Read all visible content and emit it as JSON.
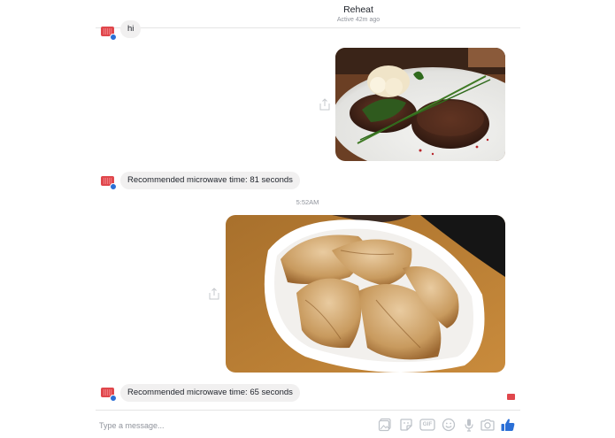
{
  "header": {
    "title": "Reheat",
    "status": "Active 42m ago"
  },
  "messages": [
    {
      "type": "text",
      "from": "bot",
      "text": "hi"
    },
    {
      "type": "image",
      "from": "user",
      "alt": "steak"
    },
    {
      "type": "text",
      "from": "bot",
      "text": "Recommended microwave time: 81 seconds"
    },
    {
      "type": "timestamp",
      "text": "5:52AM"
    },
    {
      "type": "image",
      "from": "user",
      "alt": "dumplings"
    },
    {
      "type": "text",
      "from": "bot",
      "text": "Recommended microwave time: 65 seconds"
    }
  ],
  "composer": {
    "placeholder": "Type a message...",
    "icons": [
      "photos-icon",
      "sticker-icon",
      "gif-icon",
      "emoji-icon",
      "mic-icon",
      "camera-icon",
      "like-icon"
    ],
    "gif_label": "GIF"
  },
  "colors": {
    "accent": "#0084ff",
    "bubble": "#f1f0f0",
    "avatar": "#e0474c"
  }
}
